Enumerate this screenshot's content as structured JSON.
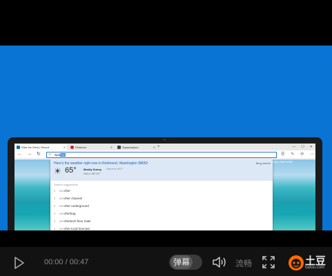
{
  "player": {
    "time": "00:00 / 00:47",
    "danmu_label": "弹幕",
    "quality_label": "流畅",
    "logo_text": "土豆",
    "logo_domain": "tudou.com",
    "accent_color": "#ff6a00"
  },
  "browser": {
    "tabs": [
      {
        "label": "Ride the Wind | Resort",
        "active": true
      },
      {
        "label": "Pinterest",
        "active": false
      },
      {
        "label": "Squarespace",
        "active": false
      }
    ],
    "address": {
      "typed": "wea",
      "selected": "ther"
    },
    "page_contact": "+1(55) 2385 6789"
  },
  "weather": {
    "headline": "Here's the weather right now in Redmond, Washington 98052",
    "bing_link": "Bing search",
    "temperature": "65°",
    "condition": "Mostly Sunny",
    "hilo": "Hi/Lo: 68°/47°",
    "source": "Data from MOT"
  },
  "suggestions": {
    "title": "Search suggestions",
    "items": [
      {
        "prefix": "wea",
        "rest": "ther"
      },
      {
        "prefix": "wea",
        "rest": "ther channel"
      },
      {
        "prefix": "wea",
        "rest": "ther underground"
      },
      {
        "prefix": "wea",
        "rest": "therbug"
      },
      {
        "prefix": "wea",
        "rest": "thertech floor mats"
      },
      {
        "prefix": "wea",
        "rest": "ther local forecast"
      }
    ]
  }
}
